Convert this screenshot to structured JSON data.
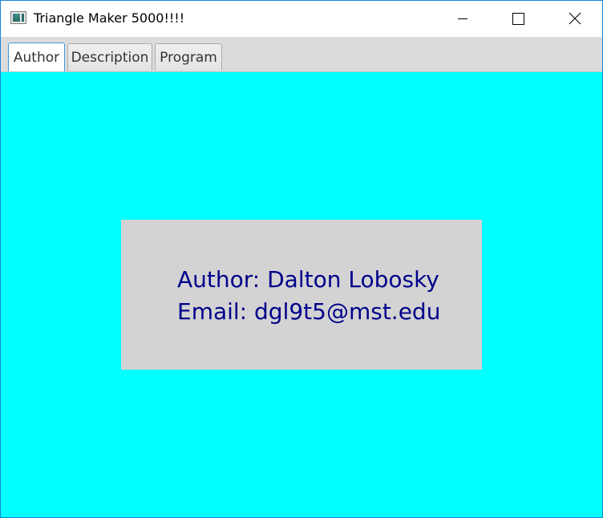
{
  "window": {
    "title": "Triangle Maker 5000!!!!",
    "icon": "app-window-icon",
    "controls": [
      "minimize-icon",
      "maximize-icon",
      "close-icon"
    ]
  },
  "tabs": [
    {
      "label": "Author",
      "active": true
    },
    {
      "label": "Description",
      "active": false
    },
    {
      "label": "Program",
      "active": false
    }
  ],
  "author_panel": {
    "author_line": "Author: Dalton Lobosky",
    "email_line": "Email: dgl9t5@mst.edu"
  },
  "colors": {
    "content_background": "#00ffff",
    "info_box_background": "#d3d3d3",
    "info_text": "#00008b",
    "active_tab_border": "#3c9ad8",
    "window_border": "#1883d7"
  }
}
